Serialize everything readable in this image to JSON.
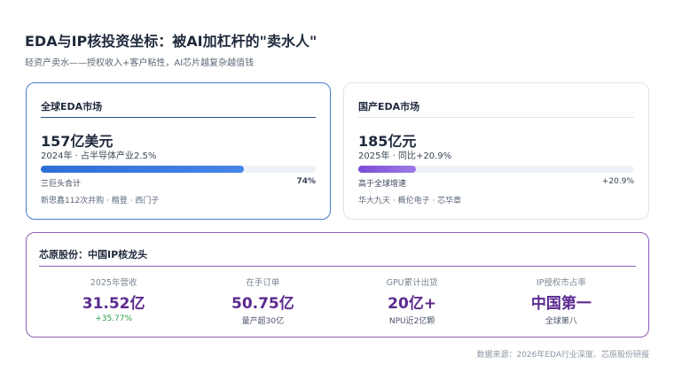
{
  "header": {
    "title": "EDA与IP核投资坐标：被AI加杠杆的\"卖水人\"",
    "subtitle": "轻资产卖水——授权收入+客户粘性，AI芯片越复杂越值钱"
  },
  "global_card": {
    "title": "全球EDA市场",
    "value": "157亿美元",
    "detail": "2024年 · 占半导体产业2.5%",
    "bar_label": "三巨头合计",
    "bar_percent_text": "74%",
    "bar_fraction": 0.74,
    "note": "新思鑫112次并购 · 楷登 · 西门子",
    "accent_color": "#2c6fd6"
  },
  "domestic_card": {
    "title": "国产EDA市场",
    "value": "185亿元",
    "detail": "2025年 · 同比+20.9%",
    "bar_label": "高于全球增速",
    "bar_percent_text": "+20.9%",
    "bar_fraction": 0.209,
    "note": "华大九天 · 概伦电子 · 芯华章",
    "accent_color": "#7b4cd6"
  },
  "vsi_card": {
    "title": "芯原股份：中国IP核龙头",
    "metrics": [
      {
        "label": "2025年营收",
        "value": "31.52亿",
        "sub": "+35.77%",
        "sub_positive": true
      },
      {
        "label": "在手订单",
        "value": "50.75亿",
        "sub": "量产超30亿",
        "sub_positive": false
      },
      {
        "label": "GPU累计出货",
        "value": "20亿+",
        "sub": "NPU近2亿颗",
        "sub_positive": false
      },
      {
        "label": "IP授权市占率",
        "value": "中国第一",
        "sub": "全球第八",
        "sub_positive": false
      }
    ],
    "accent_color": "#5b2a8f"
  },
  "footer": {
    "source": "数据来源：2026年EDA行业深度、芯原股份研报"
  }
}
